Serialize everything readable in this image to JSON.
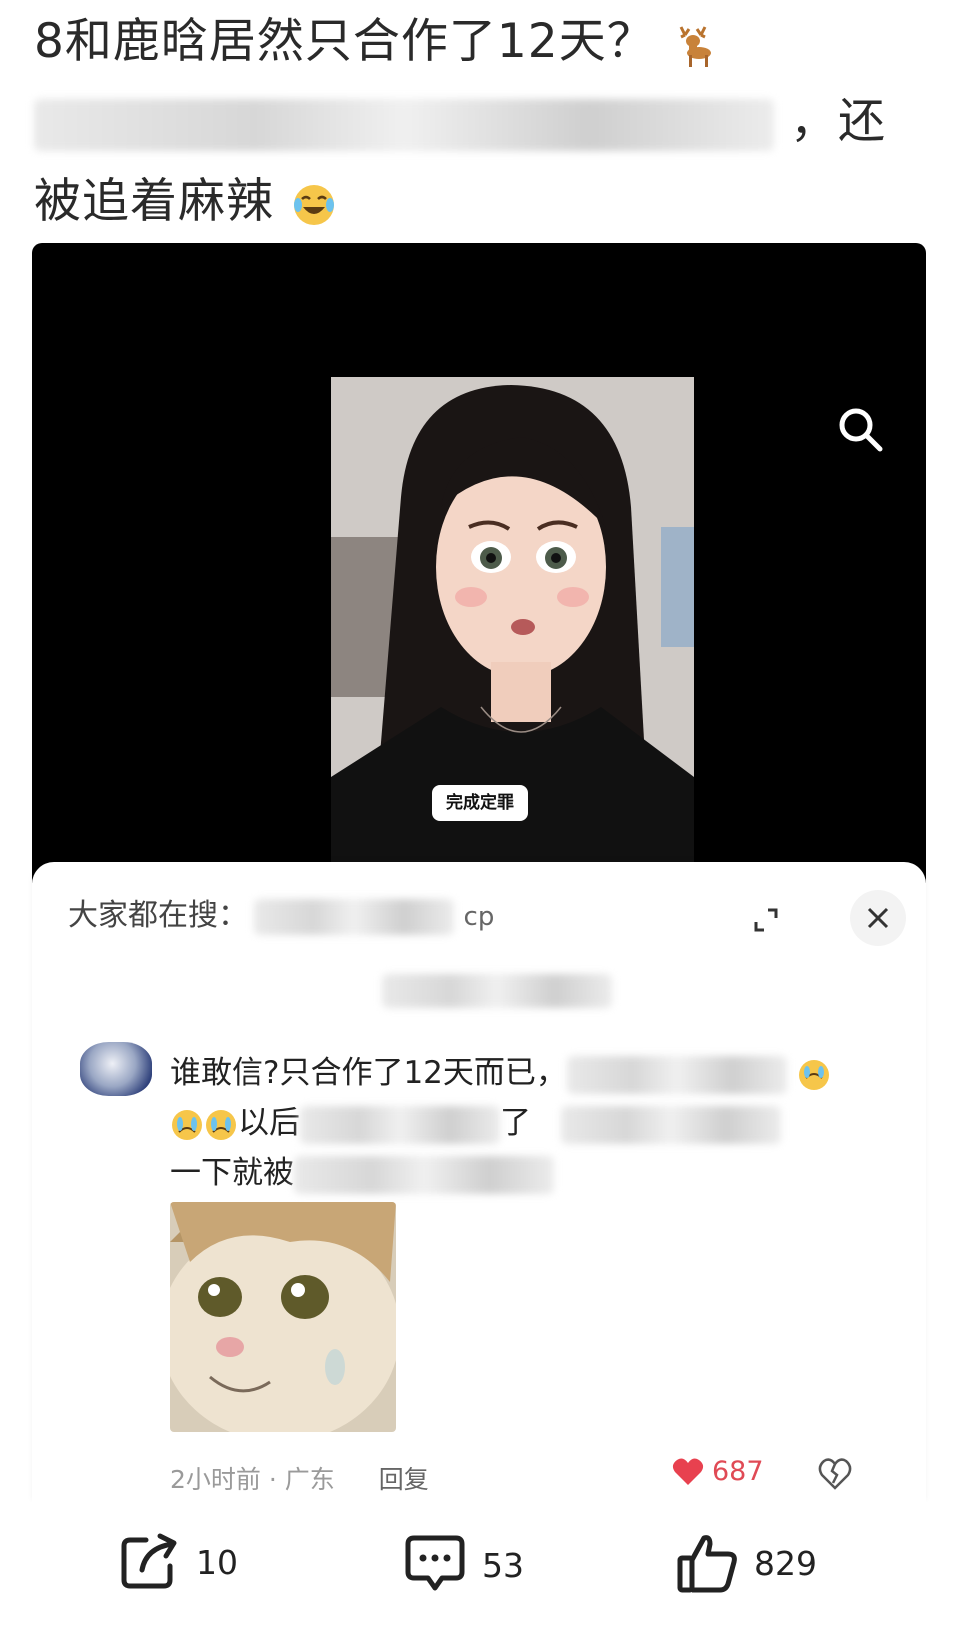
{
  "post": {
    "title_line1": "8和鹿晗居然只合作了12天？",
    "title_line2_tail": "，还",
    "title_line3": "被追着麻辣",
    "deer_icon": "deer-icon",
    "laugh_icon": "laughing-tears-icon"
  },
  "video": {
    "overlay_tag": "完成定罪"
  },
  "comments_sheet": {
    "hot_search_label": "大家都在搜：",
    "hot_search_query_tail": "cp",
    "comment_text_1": "谁敢信?只合作了12天而已，",
    "comment_text_2": "以后",
    "comment_text_2b": "了",
    "comment_text_3": "一下就被",
    "time_location": "2小时前 · 广东",
    "reply_label": "回复",
    "like_count": "687"
  },
  "action_bar": {
    "share_count": "10",
    "comment_count": "53",
    "like_count": "829"
  },
  "colors": {
    "like_red": "#e04a55",
    "video_bg": "#000000"
  }
}
